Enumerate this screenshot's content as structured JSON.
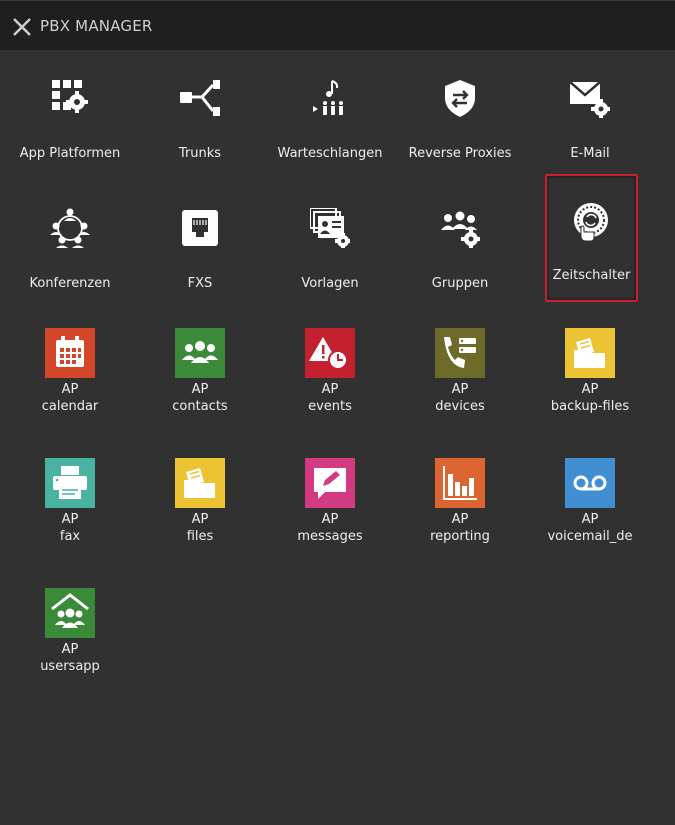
{
  "header": {
    "title": "PBX MANAGER",
    "close_icon": "close-icon"
  },
  "tiles": [
    {
      "label": "App Platformen",
      "icon": "apps-gear-icon"
    },
    {
      "label": "Trunks",
      "icon": "trunk-branch-icon"
    },
    {
      "label": "Warteschlangen",
      "icon": "queue-music-icon"
    },
    {
      "label": "Reverse Proxies",
      "icon": "shield-arrows-icon"
    },
    {
      "label": "E-Mail",
      "icon": "mail-gear-icon"
    },
    {
      "label": "Konferenzen",
      "icon": "conference-icon"
    },
    {
      "label": "FXS",
      "icon": "phone-jack-icon"
    },
    {
      "label": "Vorlagen",
      "icon": "templates-icon"
    },
    {
      "label": "Gruppen",
      "icon": "groups-gear-icon"
    },
    {
      "label": "Zeitschalter",
      "icon": "timer-dial-icon",
      "selected": true
    }
  ],
  "apps": [
    {
      "prefix": "AP",
      "name": "calendar",
      "color": "#d4462a",
      "icon": "calendar-icon"
    },
    {
      "prefix": "AP",
      "name": "contacts",
      "color": "#3a8a3a",
      "icon": "contacts-icon"
    },
    {
      "prefix": "AP",
      "name": "events",
      "color": "#c42130",
      "icon": "alert-clock-icon"
    },
    {
      "prefix": "AP",
      "name": "devices",
      "color": "#6e6a2a",
      "icon": "phone-list-icon"
    },
    {
      "prefix": "AP",
      "name": "backup-files",
      "color": "#ecc332",
      "icon": "folder-file-icon"
    },
    {
      "prefix": "AP",
      "name": "fax",
      "color": "#48b3a0",
      "icon": "printer-icon"
    },
    {
      "prefix": "AP",
      "name": "files",
      "color": "#ecc332",
      "icon": "folder-file-icon"
    },
    {
      "prefix": "AP",
      "name": "messages",
      "color": "#d43a82",
      "icon": "message-edit-icon"
    },
    {
      "prefix": "AP",
      "name": "reporting",
      "color": "#dc6430",
      "icon": "bar-chart-icon"
    },
    {
      "prefix": "AP",
      "name": "voicemail_de",
      "color": "#3f8fd2",
      "icon": "voicemail-icon"
    },
    {
      "prefix": "AP",
      "name": "usersapp",
      "color": "#3a8a3a",
      "icon": "house-users-icon"
    }
  ],
  "colors": {
    "background": "#313131",
    "header": "#1f1f1f",
    "selection": "#c8202c"
  }
}
